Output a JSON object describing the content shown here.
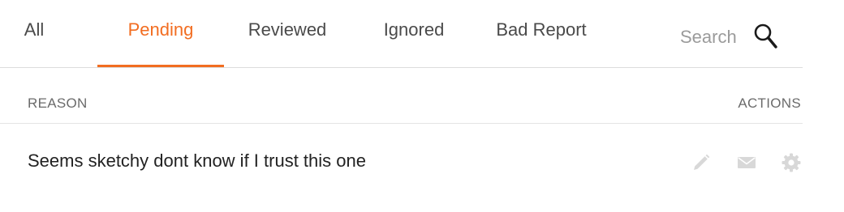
{
  "tabs": [
    {
      "label": "All",
      "active": false
    },
    {
      "label": "Pending",
      "active": true
    },
    {
      "label": "Reviewed",
      "active": false
    },
    {
      "label": "Ignored",
      "active": false
    },
    {
      "label": "Bad Report",
      "active": false
    }
  ],
  "search": {
    "placeholder": "Search",
    "value": "",
    "icon": "search-icon"
  },
  "table": {
    "columns": {
      "reason": "REASON",
      "actions": "ACTIONS"
    },
    "rows": [
      {
        "reason": "Seems sketchy dont know if I trust this one",
        "actions": [
          "edit-icon",
          "mail-icon",
          "gear-icon"
        ]
      }
    ]
  },
  "colors": {
    "accent": "#f26d21",
    "text": "#222222",
    "muted": "#6b6b6b",
    "action_icon": "#d8d8d8"
  }
}
